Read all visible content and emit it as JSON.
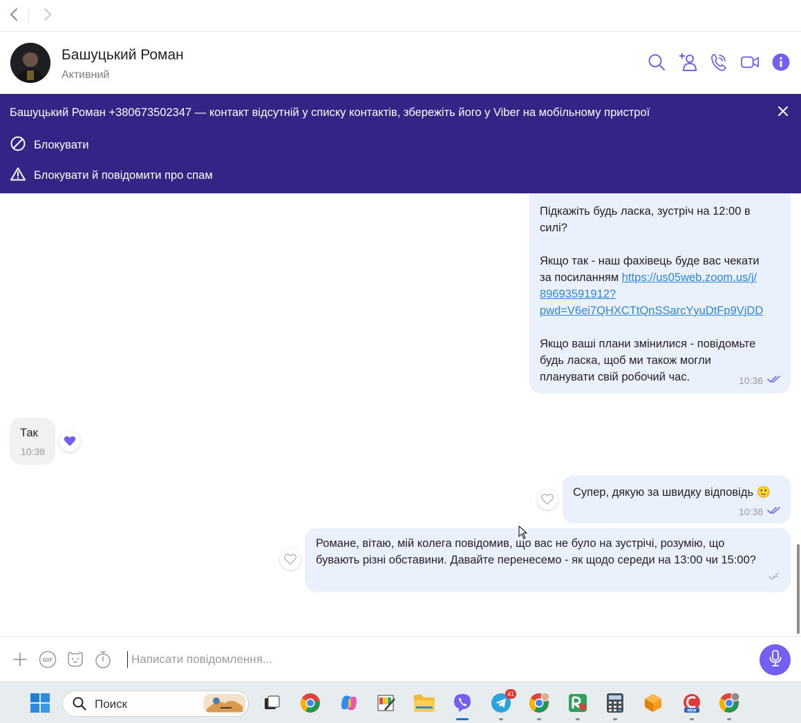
{
  "contact": {
    "name": "Башуцький Роман",
    "status": "Активний"
  },
  "banner": {
    "text": "Башуцький Роман +380673502347 — контакт відсутній у списку контактів, збережіть його у Viber на мобільному пристрої",
    "block_label": "Блокувати",
    "block_spam_label": "Блокувати й повідомити про спам"
  },
  "messages": {
    "m1": {
      "p1": "Підкажіть будь ласка, зустріч на 12:00 в\nсилі?",
      "p2a": "Якщо так - наш фахівець буде вас чекати\nза посиланням ",
      "link": "https://us05web.zoom.us/j/\n89693591912?\npwd=V6ei7QHXCTtQnSSarcYyuDtFp9VjDD",
      "p3": "Якщо ваші плани змінилися - повідомьте\nбудь ласка, щоб ми також могли\nпланувати свій робочий час.",
      "time": "10:36"
    },
    "m2": {
      "text": "Так",
      "time": "10:38"
    },
    "m3": {
      "text": "Супер, дякую за швидку відповідь",
      "emoji": "🙂",
      "time": "10:38"
    },
    "m4": {
      "text": "Романе, вітаю, мій колега повідомив, що вас не було на зустрічі, розумію, що\nбувають різні обставини. Давайте перенесемо - як щодо середи на 13:00 чи 15:00?"
    }
  },
  "composer": {
    "placeholder": "Написати повідомлення..."
  },
  "taskbar": {
    "search_label": "Поиск",
    "telegram_badge": "41"
  },
  "colors": {
    "accent": "#7360f2",
    "banner": "#332485",
    "bubble_out": "#eaf0fc",
    "bubble_in": "#f1f1f1"
  },
  "icons": {
    "nav": [
      "back-arrow-icon",
      "forward-arrow-icon"
    ],
    "header": [
      "search-icon",
      "add-participant-icon",
      "call-icon",
      "video-call-icon",
      "info-icon"
    ],
    "composer": [
      "plus-icon",
      "gif-icon",
      "sticker-icon",
      "timer-icon",
      "microphone-icon"
    ]
  }
}
